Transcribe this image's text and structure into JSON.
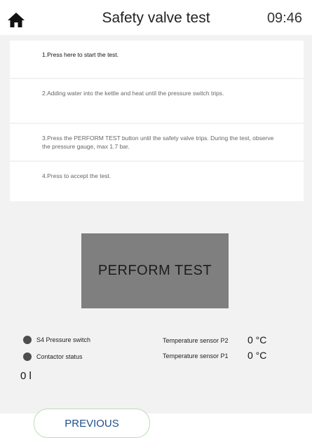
{
  "header": {
    "title": "Safety valve test",
    "time": "09:46"
  },
  "steps": [
    {
      "text": "1.Press here to start the test."
    },
    {
      "text": "2.Adding water into the kettle and heat until the pressure switch trips."
    },
    {
      "text": "3.Press the PERFORM TEST button until the safety valve trips. During the test, observe the pressure gauge, max 1.7 bar."
    },
    {
      "text": "4.Press to accept the test."
    }
  ],
  "perform_button": {
    "label": "PERFORM TEST"
  },
  "status": {
    "pressure_switch_label": "S4 Pressure switch",
    "contactor_label": "Contactor status",
    "indicator_color": "#4d4d4d"
  },
  "sensors": {
    "p2_label": "Temperature sensor P2",
    "p2_value": "0 °C",
    "p1_label": "Temperature sensor P1",
    "p1_value": "0 °C"
  },
  "level_readout": "0 l",
  "footer": {
    "previous_label": "PREVIOUS"
  }
}
